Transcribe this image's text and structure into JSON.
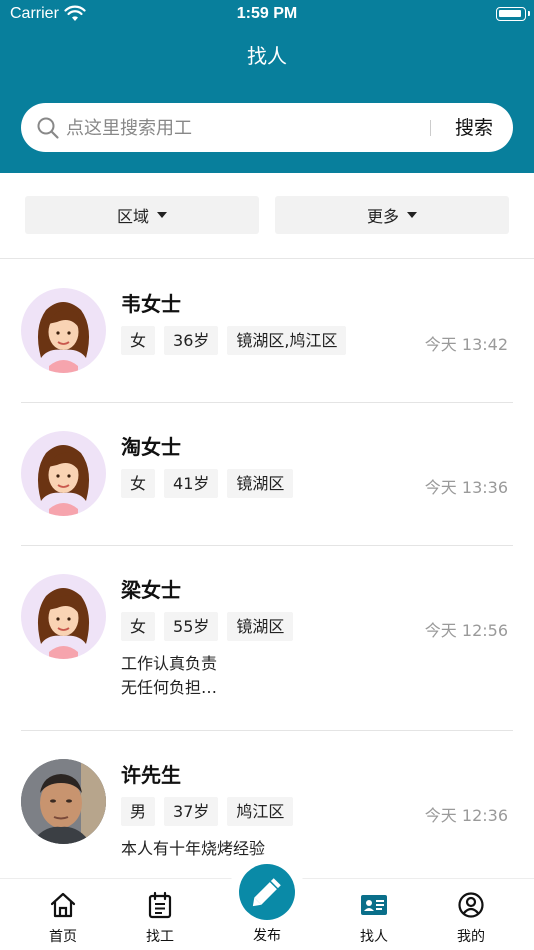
{
  "status_bar": {
    "carrier": "Carrier",
    "time": "1:59 PM"
  },
  "header": {
    "title": "找人"
  },
  "search": {
    "placeholder": "点这里搜索用工",
    "button_label": "搜索"
  },
  "filters": [
    {
      "label": "区域"
    },
    {
      "label": "更多"
    }
  ],
  "people": [
    {
      "name": "韦女士",
      "gender": "女",
      "age": "36岁",
      "area": "镜湖区,鸠江区",
      "time": "今天 13:42",
      "avatar": "female-cartoon-avatar"
    },
    {
      "name": "淘女士",
      "gender": "女",
      "age": "41岁",
      "area": "镜湖区",
      "time": "今天 13:36",
      "avatar": "female-cartoon-avatar"
    },
    {
      "name": "梁女士",
      "gender": "女",
      "age": "55岁",
      "area": "镜湖区",
      "time": "今天 12:56",
      "desc_line1": "工作认真负责",
      "desc_line2": "无任何负担…",
      "avatar": "female-cartoon-avatar"
    },
    {
      "name": "许先生",
      "gender": "男",
      "age": "37岁",
      "area": "鸠江区",
      "time": "今天 12:36",
      "desc_line1": "本人有十年烧烤经验",
      "avatar": "male-photo-avatar"
    }
  ],
  "tabbar": [
    {
      "label": "首页",
      "icon": "home-icon"
    },
    {
      "label": "找工",
      "icon": "clipboard-icon"
    },
    {
      "label": "发布",
      "icon": "pencil-icon"
    },
    {
      "label": "找人",
      "icon": "id-card-icon"
    },
    {
      "label": "我的",
      "icon": "user-circle-icon"
    }
  ],
  "colors": {
    "brand": "#087f9c",
    "publish": "#0a8aa7",
    "avatar_bg": "#efe3f7"
  }
}
